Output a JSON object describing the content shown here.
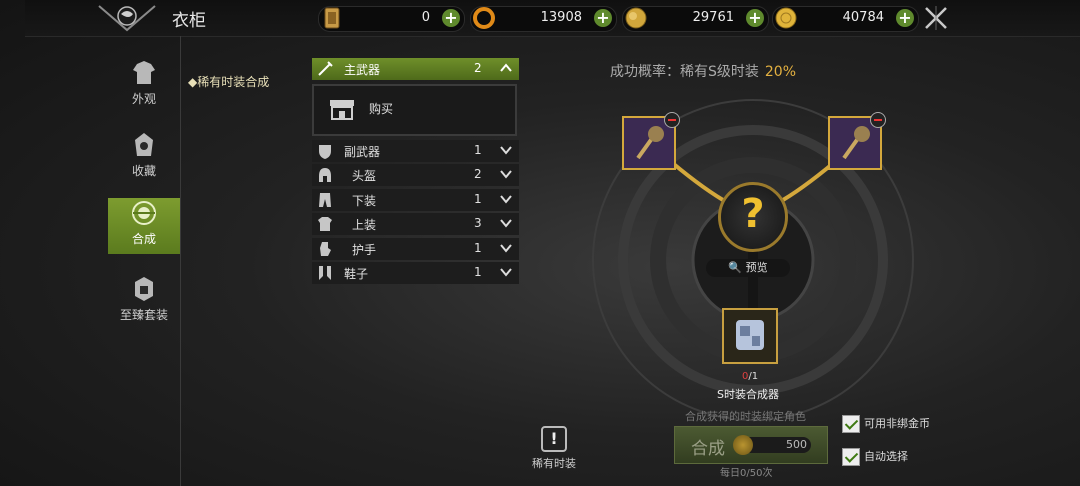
{
  "header": {
    "title": "衣柜",
    "currencies": [
      {
        "name": "ticket",
        "value": "0",
        "icon": "ticket-card-icon",
        "color": "#c89a46"
      },
      {
        "name": "crystal",
        "value": "13908",
        "icon": "orange-ring-icon",
        "color": "#e08a18"
      },
      {
        "name": "gold-bag",
        "value": "29761",
        "icon": "gold-bag-icon",
        "color": "#d1a63b"
      },
      {
        "name": "gold-coin",
        "value": "40784",
        "icon": "gold-coin-icon",
        "color": "#e0b43a"
      }
    ]
  },
  "sidebar": {
    "items": [
      {
        "label": "外观",
        "icon": "armor-icon",
        "active": false
      },
      {
        "label": "收藏",
        "icon": "collection-icon",
        "active": false
      },
      {
        "label": "合成",
        "icon": "synthesis-icon",
        "active": true
      },
      {
        "label": "至臻套装",
        "icon": "set-armor-icon",
        "active": false
      }
    ],
    "sub_item": "稀有时装合成"
  },
  "categories": {
    "main": {
      "label": "主武器",
      "count": "2"
    },
    "buy_label": "购买",
    "rows": [
      {
        "label": "副武器",
        "count": "1",
        "icon": "shield-icon"
      },
      {
        "label": "头盔",
        "count": "2",
        "icon": "helmet-icon"
      },
      {
        "label": "下装",
        "count": "1",
        "icon": "pants-icon"
      },
      {
        "label": "上装",
        "count": "3",
        "icon": "chest-armor-icon"
      },
      {
        "label": "护手",
        "count": "1",
        "icon": "gauntlet-icon"
      },
      {
        "label": "鞋子",
        "count": "1",
        "icon": "boots-icon"
      }
    ]
  },
  "synthesis": {
    "rate_label": "成功概率：稀有S级时装",
    "rate_value": "20%",
    "question_mark": "?",
    "preview_label": "预览",
    "material_count_have": "0",
    "material_count_need": "/1",
    "material_name": "S时装合成器",
    "bind_note": "合成获得的时装绑定角色",
    "button_label": "合成",
    "cost": "500",
    "daily_limit": "每日0/50次",
    "rare_label": "稀有时装",
    "rare_icon_glyph": "!"
  },
  "options": {
    "use_unbound_gold": "可用非绑金币",
    "auto_select": "自动选择"
  },
  "colors": {
    "accent_green": "#6f8f2a",
    "gold": "#e3b040"
  }
}
